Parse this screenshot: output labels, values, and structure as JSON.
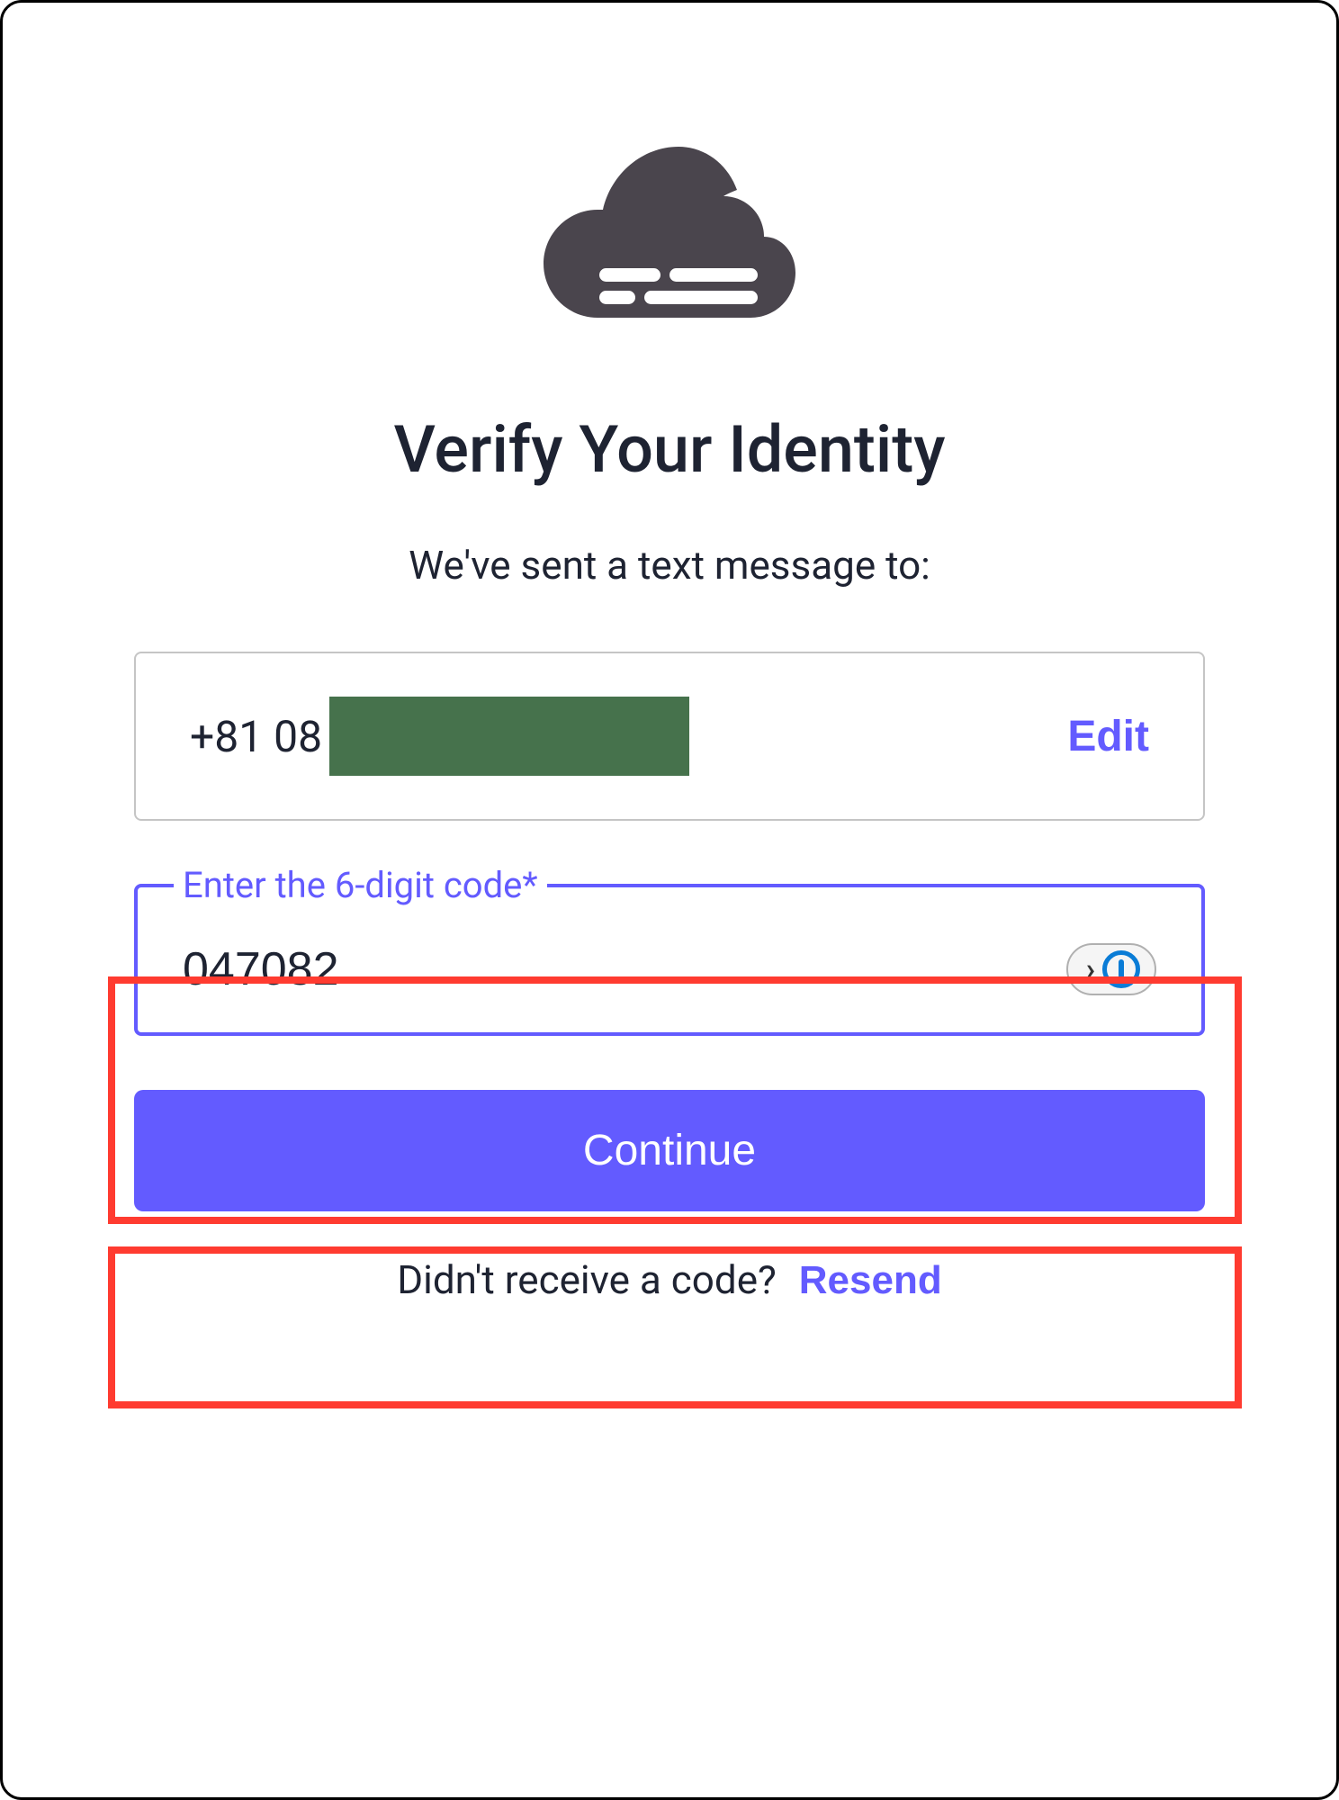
{
  "title": "Verify Your Identity",
  "subtitle": "We've sent a text message to:",
  "phone": {
    "visible_prefix": "+81 08",
    "edit_label": "Edit"
  },
  "code_field": {
    "label": "Enter the 6-digit code*",
    "value": "047082"
  },
  "continue_label": "Continue",
  "resend": {
    "prompt": "Didn't receive a code?",
    "action_label": "Resend"
  },
  "icons": {
    "logo": "cloud-logo-icon",
    "password_manager": "onepassword-icon"
  },
  "colors": {
    "accent": "#635bff",
    "highlight": "#ff3b30",
    "redaction": "#46724c",
    "text": "#1e2332"
  }
}
